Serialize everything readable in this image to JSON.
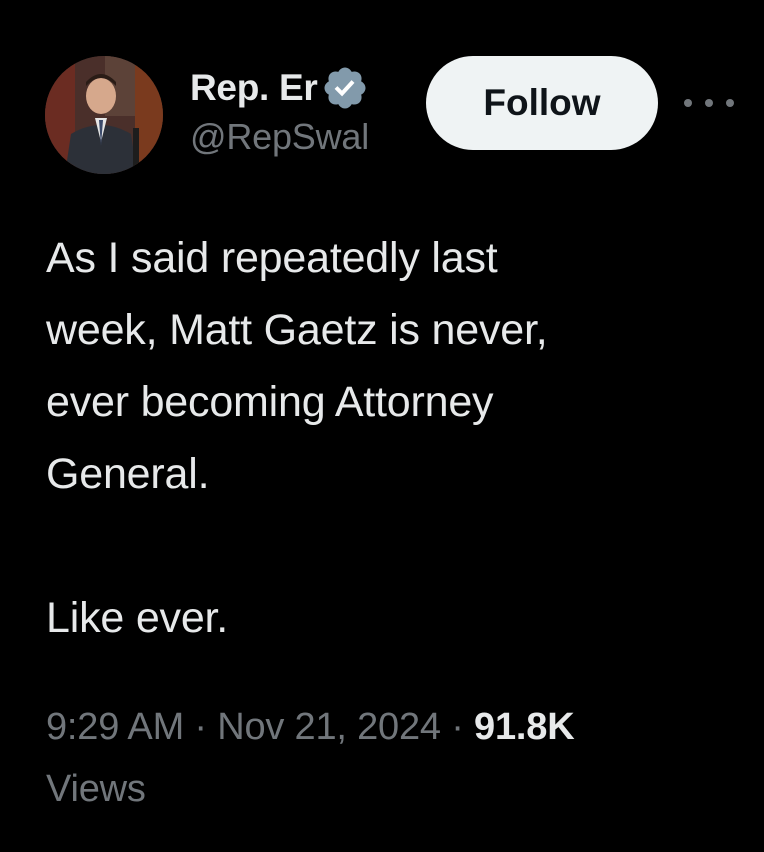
{
  "author": {
    "display_name": "Rep. Er",
    "handle": "@RepSwal",
    "verified": true,
    "verified_color": "#829aab"
  },
  "actions": {
    "follow_label": "Follow",
    "more_icon": "more-horizontal-icon"
  },
  "tweet": {
    "lines": [
      "As I said repeatedly last",
      "week, Matt Gaetz is never,",
      "ever becoming Attorney",
      "General."
    ],
    "second_paragraph": "Like ever."
  },
  "meta": {
    "time": "9:29 AM",
    "separator": " · ",
    "date": "Nov 21, 2024",
    "views_count": "91.8K",
    "views_label": "Views"
  },
  "colors": {
    "background": "#000000",
    "primary_text": "#e7e9ea",
    "secondary_text": "#71767b",
    "follow_bg": "#eff3f4"
  }
}
